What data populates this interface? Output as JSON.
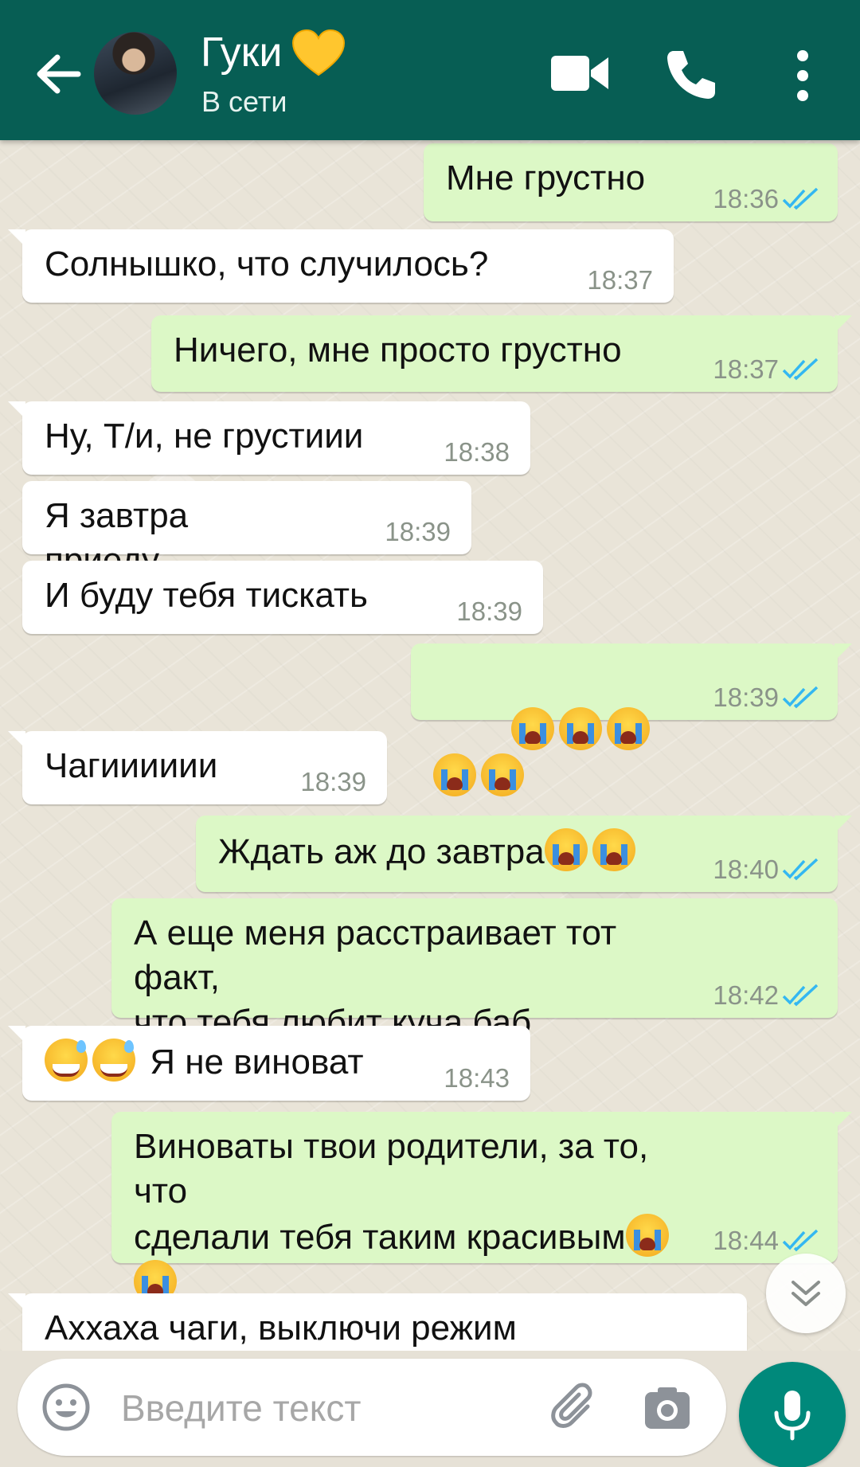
{
  "header": {
    "contact_name": "Гуки",
    "status": "В сети",
    "accent_color": "#075e54",
    "icons": [
      "back-arrow-icon",
      "yellow-heart-icon",
      "video-call-icon",
      "phone-icon",
      "more-vertical-icon"
    ]
  },
  "messages": [
    {
      "dir": "out",
      "text": "Мне грустно",
      "time": "18:36"
    },
    {
      "dir": "in",
      "text": "Солнышко, что случилось?",
      "time": "18:37"
    },
    {
      "dir": "out",
      "text": "Ничего, мне просто грустно",
      "time": "18:37"
    },
    {
      "dir": "in",
      "text": "Ну, Т/и, не грустиии",
      "time": "18:38"
    },
    {
      "dir": "in",
      "text": "Я завтра приеду",
      "time": "18:39"
    },
    {
      "dir": "in",
      "text": "И буду тебя тискать",
      "time": "18:39"
    },
    {
      "dir": "out",
      "text": "",
      "emoji": "😭😭😭😭😭",
      "time": "18:39"
    },
    {
      "dir": "in",
      "text": "Чагииииии",
      "time": "18:39"
    },
    {
      "dir": "out",
      "text": "Ждать аж до завтра",
      "emoji": "😭😭",
      "time": "18:40"
    },
    {
      "dir": "out",
      "text": "А еще меня расстраивает тот факт,\nчто тебя любит куча баб",
      "time": "18:42"
    },
    {
      "dir": "in",
      "text": "Я не виноват",
      "emoji": "😅😅",
      "time": "18:43"
    },
    {
      "dir": "out",
      "text": "Виноваты твои родители, за то, что\nсделали тебя таким красивым",
      "emoji": "😭😭😭😭😭",
      "time": "18:44"
    },
    {
      "dir": "in",
      "text": "Аххаха чаги, выключи режим"
    }
  ],
  "input": {
    "placeholder": "Введите текст"
  }
}
